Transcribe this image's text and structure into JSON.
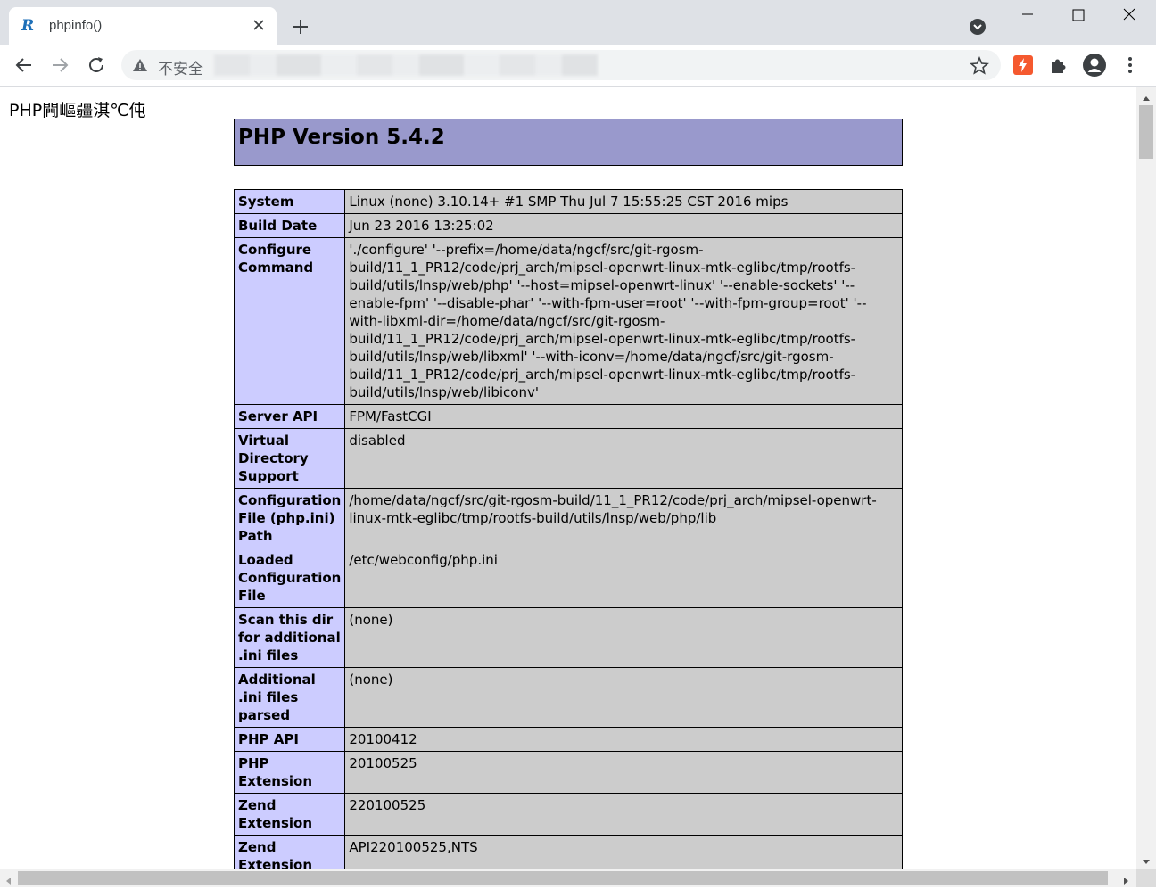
{
  "browser": {
    "tab_title": "phpinfo()",
    "favicon_letter": "R",
    "not_secure_label": "不安全"
  },
  "page": {
    "garbled_title": "PHP闁嶇疆淇℃伅",
    "header_title": "PHP Version 5.4.2",
    "rows": [
      {
        "key": "System",
        "value": "Linux (none) 3.10.14+ #1 SMP Thu Jul 7 15:55:25 CST 2016 mips"
      },
      {
        "key": "Build Date",
        "value": "Jun 23 2016 13:25:02"
      },
      {
        "key": "Configure Command",
        "value": "'./configure' '--prefix=/home/data/ngcf/src/git-rgosm-build/11_1_PR12/code/prj_arch/mipsel-openwrt-linux-mtk-eglibc/tmp/rootfs-build/utils/lnsp/web/php' '--host=mipsel-openwrt-linux' '--enable-sockets' '--enable-fpm' '--disable-phar' '--with-fpm-user=root' '--with-fpm-group=root' '--with-libxml-dir=/home/data/ngcf/src/git-rgosm-build/11_1_PR12/code/prj_arch/mipsel-openwrt-linux-mtk-eglibc/tmp/rootfs-build/utils/lnsp/web/libxml' '--with-iconv=/home/data/ngcf/src/git-rgosm-build/11_1_PR12/code/prj_arch/mipsel-openwrt-linux-mtk-eglibc/tmp/rootfs-build/utils/lnsp/web/libiconv'"
      },
      {
        "key": "Server API",
        "value": "FPM/FastCGI"
      },
      {
        "key": "Virtual Directory Support",
        "value": "disabled"
      },
      {
        "key": "Configuration File (php.ini) Path",
        "value": "/home/data/ngcf/src/git-rgosm-build/11_1_PR12/code/prj_arch/mipsel-openwrt-linux-mtk-eglibc/tmp/rootfs-build/utils/lnsp/web/php/lib"
      },
      {
        "key": "Loaded Configuration File",
        "value": "/etc/webconfig/php.ini"
      },
      {
        "key": "Scan this dir for additional .ini files",
        "value": "(none)"
      },
      {
        "key": "Additional .ini files parsed",
        "value": "(none)"
      },
      {
        "key": "PHP API",
        "value": "20100412"
      },
      {
        "key": "PHP Extension",
        "value": "20100525"
      },
      {
        "key": "Zend Extension",
        "value": "220100525"
      },
      {
        "key": "Zend Extension Build",
        "value": "API220100525,NTS"
      }
    ]
  },
  "colors": {
    "header_bg": "#9999cc",
    "key_bg": "#ccccff",
    "value_bg": "#cccccc",
    "tabstrip_bg": "#dee1e6",
    "ext_accent": "#f5592f"
  },
  "icons": {
    "tab_close": "close-icon",
    "new_tab": "plus-icon",
    "back": "arrow-left-icon",
    "forward": "arrow-right-icon",
    "reload": "reload-icon",
    "warning": "warning-icon",
    "bookmark": "star-icon",
    "extensions": "puzzle-icon",
    "profile": "account-icon",
    "menu": "more-vert-icon"
  }
}
